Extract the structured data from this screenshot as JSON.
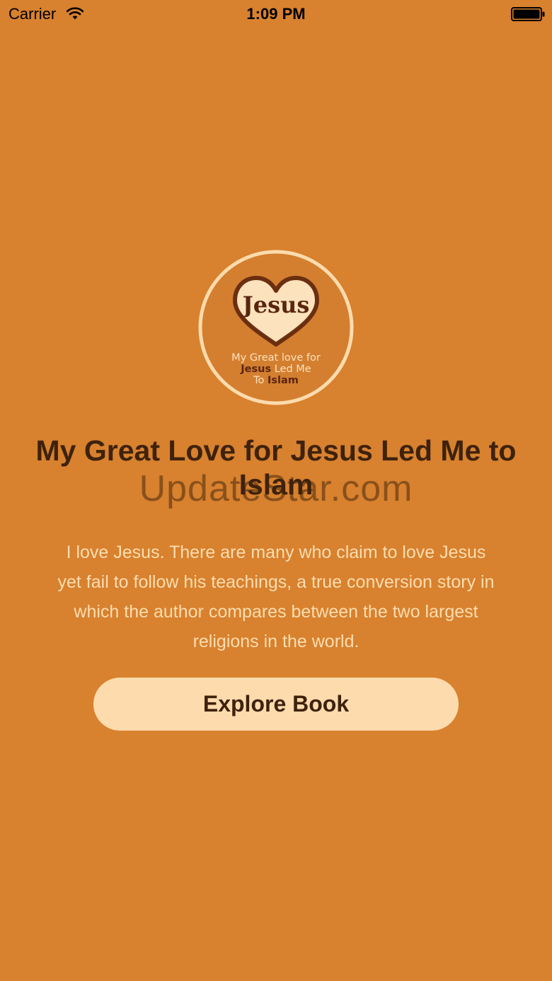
{
  "status_bar": {
    "carrier": "Carrier",
    "time": "1:09 PM"
  },
  "logo": {
    "heart_word": "Jesus",
    "line1": "My Great love for",
    "line2_strong": "Jesus",
    "line2_rest": " Led Me",
    "line3_pre": "To ",
    "line3_strong": "Islam"
  },
  "main": {
    "title": "My Great Love for Jesus Led Me to Islam",
    "watermark": "UpdateStar.com",
    "description": "I love Jesus. There are many who claim to love Jesus yet fail to follow his teachings, a true conversion story in which the author compares between the two largest religions in the world.",
    "button_label": "Explore Book"
  },
  "colors": {
    "background": "#D8812E",
    "title_text": "#3E220D",
    "description_text": "#FCDDB0",
    "button_background": "#FDDBAD",
    "logo_ring": "#FDDBAD",
    "logo_heart_outline": "#6B2F10"
  }
}
